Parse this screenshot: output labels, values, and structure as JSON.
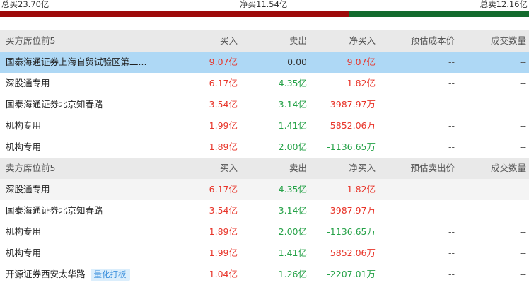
{
  "summary": {
    "total_buy": "总买23.70亿",
    "net_buy": "净买11.54亿",
    "total_sell": "总卖12.16亿",
    "buy_fraction": 0.6609,
    "buy_color": "#9e0a0a",
    "sell_color": "#136b2d"
  },
  "colors": {
    "up": "#e8352a",
    "down": "#26a248",
    "selected": "#aed8f5",
    "header": "#e9e9e9"
  },
  "buy_section": {
    "headers": [
      "买方席位前5",
      "买入",
      "卖出",
      "净买入",
      "预估成本价",
      "成交数量"
    ],
    "rows": [
      {
        "name": "国泰海通证券上海自贸试验区第二...",
        "buy": "9.07亿",
        "sell": "0.00",
        "net": "9.07亿",
        "cost": "--",
        "volume": "--",
        "selected": true
      },
      {
        "name": "深股通专用",
        "buy": "6.17亿",
        "sell": "4.35亿",
        "net": "1.82亿",
        "cost": "--",
        "volume": "--"
      },
      {
        "name": "国泰海通证券北京知春路",
        "buy": "3.54亿",
        "sell": "3.14亿",
        "net": "3987.97万",
        "cost": "--",
        "volume": "--"
      },
      {
        "name": "机构专用",
        "buy": "1.99亿",
        "sell": "1.41亿",
        "net": "5852.06万",
        "cost": "--",
        "volume": "--"
      },
      {
        "name": "机构专用",
        "buy": "1.89亿",
        "sell": "2.00亿",
        "net": "-1136.65万",
        "cost": "--",
        "volume": "--"
      }
    ]
  },
  "sell_section": {
    "headers": [
      "卖方席位前5",
      "买入",
      "卖出",
      "净买入",
      "预估卖出价",
      "成交数量"
    ],
    "rows": [
      {
        "name": "深股通专用",
        "buy": "6.17亿",
        "sell": "4.35亿",
        "net": "1.82亿",
        "cost": "--",
        "volume": "--",
        "alt": true
      },
      {
        "name": "国泰海通证券北京知春路",
        "buy": "3.54亿",
        "sell": "3.14亿",
        "net": "3987.97万",
        "cost": "--",
        "volume": "--"
      },
      {
        "name": "机构专用",
        "buy": "1.89亿",
        "sell": "2.00亿",
        "net": "-1136.65万",
        "cost": "--",
        "volume": "--"
      },
      {
        "name": "机构专用",
        "buy": "1.99亿",
        "sell": "1.41亿",
        "net": "5852.06万",
        "cost": "--",
        "volume": "--"
      },
      {
        "name": "开源证券西安太华路",
        "tag": "量化打板",
        "buy": "1.04亿",
        "sell": "1.26亿",
        "net": "-2207.01万",
        "cost": "--",
        "volume": "--"
      }
    ]
  }
}
